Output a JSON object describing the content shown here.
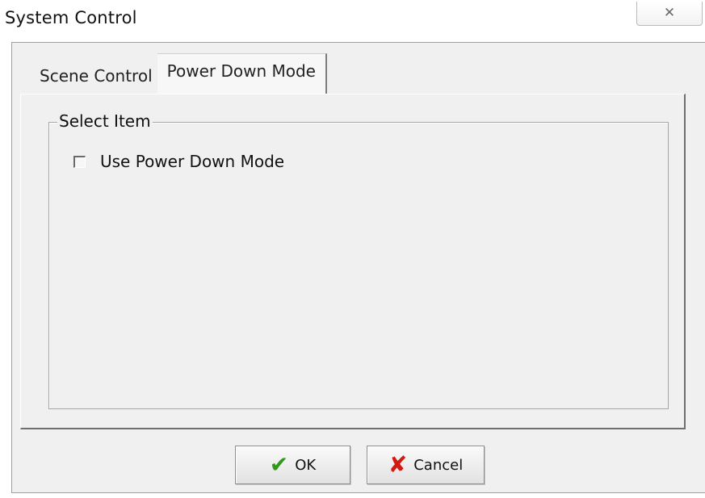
{
  "window": {
    "title": "System Control",
    "close_label": "✕"
  },
  "tabs": [
    {
      "label": "Scene Control",
      "active": false
    },
    {
      "label": "Power Down Mode",
      "active": true
    }
  ],
  "panel": {
    "group_label": "Select Item",
    "checkbox": {
      "label": "Use Power Down Mode",
      "checked": false
    }
  },
  "buttons": {
    "ok": {
      "label": "OK",
      "icon": "check-icon"
    },
    "cancel": {
      "label": "Cancel",
      "icon": "x-icon"
    }
  }
}
